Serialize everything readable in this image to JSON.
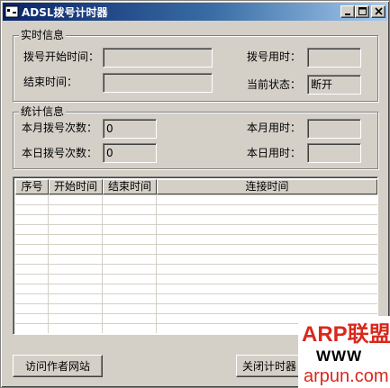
{
  "window": {
    "title": "ADSL拨号计时器",
    "controls": {
      "minimize": "minimize-icon",
      "maximize": "maximize-icon",
      "close": "close-icon"
    }
  },
  "realtime": {
    "group_title": "实时信息",
    "dial_start_label": "拨号开始时间：",
    "dial_start_value": "",
    "end_time_label": "结束时间：",
    "end_time_value": "",
    "dial_duration_label": "拨号用时：",
    "dial_duration_value": "",
    "status_label": "当前状态：",
    "status_value": "断开"
  },
  "stats": {
    "group_title": "统计信息",
    "month_count_label": "本月拨号次数：",
    "month_count_value": "0",
    "day_count_label": "本日拨号次数：",
    "day_count_value": "0",
    "month_time_label": "本月用时：",
    "month_time_value": "",
    "day_time_label": "本日用时：",
    "day_time_value": ""
  },
  "list": {
    "columns": [
      "序号",
      "开始时间",
      "结束时间",
      "连接时间"
    ],
    "rows": []
  },
  "buttons": {
    "visit_author": "访问作者网站",
    "close_timer": "关闭计时器"
  },
  "watermark": {
    "line1": "ARP联盟",
    "line2": "WWW",
    "line3": "arpun.com"
  },
  "colors": {
    "titlebar_start": "#0a246a",
    "titlebar_end": "#a6caf0",
    "face": "#d4d0c8",
    "watermark_red": "#d9281c"
  }
}
